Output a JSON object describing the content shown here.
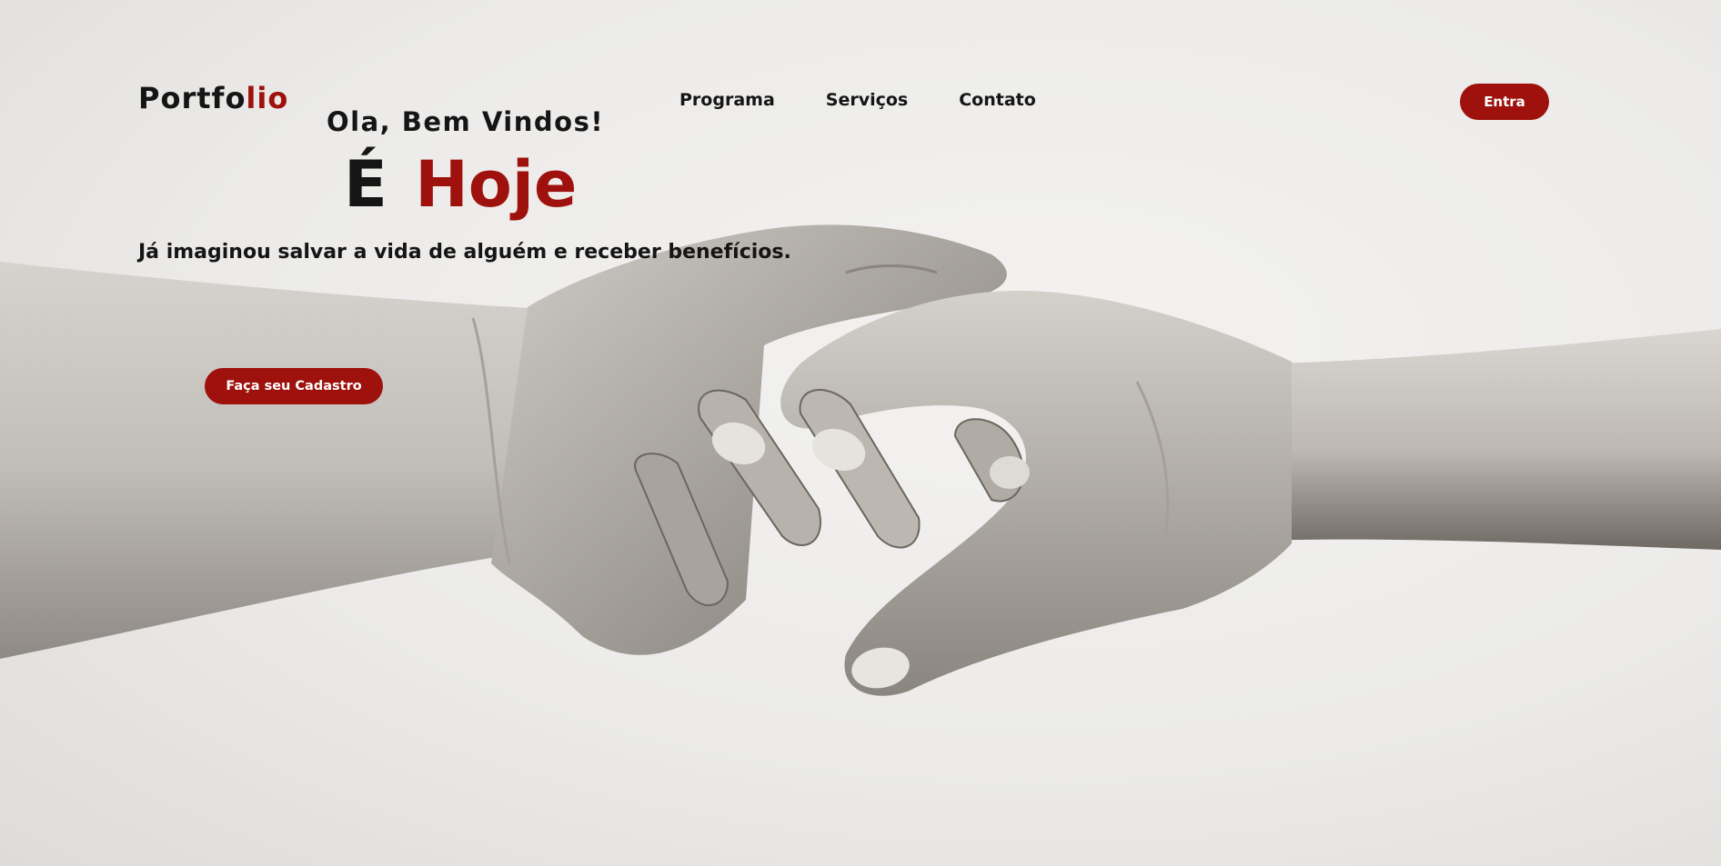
{
  "brand": {
    "logo_part1": "Portfo",
    "logo_part2": "lio",
    "accent_color": "#9e110c"
  },
  "nav": {
    "items": [
      {
        "label": "Programa"
      },
      {
        "label": "Serviços"
      },
      {
        "label": "Contato"
      }
    ],
    "login_label": "Entra"
  },
  "hero": {
    "greeting": "Ola, Bem Vindos!",
    "headline_part1": "É",
    "headline_part2": "Hoje",
    "subtext": "Já imaginou salvar a vida de alguém e receber benefícios.",
    "cta_label": "Faça seu Cadastro",
    "image_icon": "clasped-hands-image"
  }
}
